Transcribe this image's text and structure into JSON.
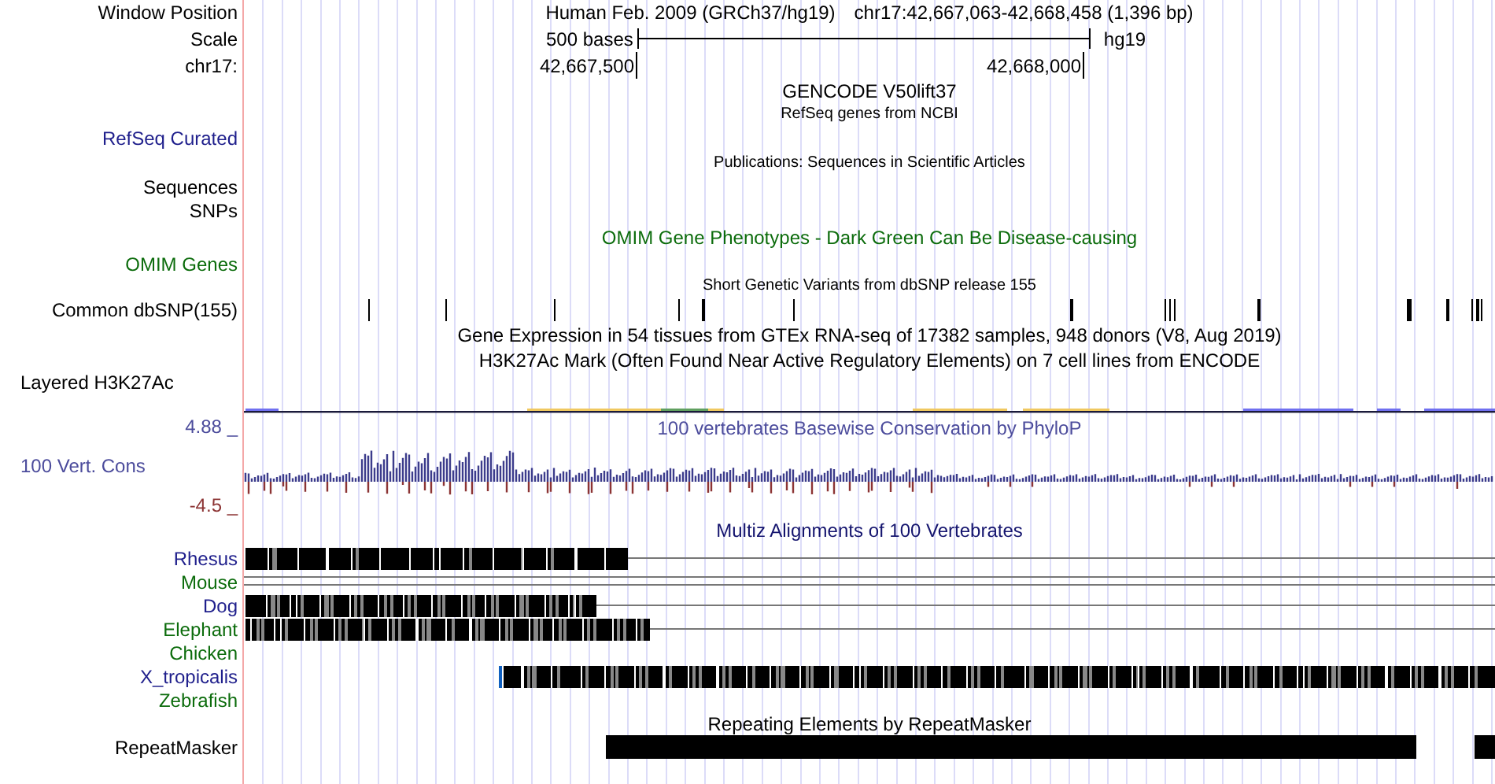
{
  "position_row": {
    "label": "Window Position",
    "assembly": "Human Feb. 2009 (GRCh37/hg19)",
    "position": "chr17:42,667,063-42,668,458 (1,396 bp)"
  },
  "scale_row": {
    "label": "Scale",
    "length": "500 bases",
    "assembly": "hg19"
  },
  "ruler_row": {
    "label": "chr17:",
    "ticks": [
      "42,667,500",
      "42,668,000"
    ]
  },
  "tracks": [
    {
      "kind": "gencode",
      "title": "GENCODE V50lift37"
    },
    {
      "kind": "refseq",
      "title": "RefSeq genes from NCBI",
      "label": "RefSeq Curated",
      "color": "#1f1f8c"
    },
    {
      "kind": "publications",
      "title": "Publications: Sequences in Scientific Articles",
      "label_lines": [
        "Sequences",
        "SNPs"
      ]
    },
    {
      "kind": "omim",
      "title": "OMIM Gene Phenotypes - Dark Green Can Be Disease-causing",
      "label": "OMIM Genes",
      "color": "#0c6c0c"
    },
    {
      "kind": "snps",
      "title": "Short Genetic Variants from dbSNP release 155",
      "label": "Common dbSNP(155)",
      "color": "#000000"
    },
    {
      "kind": "expression",
      "title": "Gene Expression in 54 tissues from GTEx RNA-seq of 17382 samples, 948 donors (V8, Aug 2019)"
    },
    {
      "kind": "layered",
      "title": "H3K27Ac Mark (Often Found Near Active Regulatory Elements) on 7 cell lines from ENCODE",
      "label": "Layered H3K27Ac",
      "color": "#000000"
    },
    {
      "kind": "conservation",
      "title": "100 vertebrates Basewise Conservation by PhyloP",
      "label": "100 Vert. Cons",
      "max": "4.88 _",
      "min": "-4.5 _",
      "color": "#4c4c9c"
    },
    {
      "kind": "multiz",
      "title": "Multiz Alignments of 100 Vertebrates",
      "species": [
        {
          "name": "Rhesus",
          "color": "#1f1f8c"
        },
        {
          "name": "Mouse",
          "color": "#0c6c0c"
        },
        {
          "name": "Dog",
          "color": "#1f1f8c"
        },
        {
          "name": "Elephant",
          "color": "#0c6c0c"
        },
        {
          "name": "Chicken",
          "color": "#0c6c0c"
        },
        {
          "name": "X_tropicalis",
          "color": "#1f1f8c"
        },
        {
          "name": "Zebrafish",
          "color": "#0c6c0c"
        }
      ]
    },
    {
      "kind": "repeats",
      "title": "Repeating Elements by RepeatMasker",
      "label": "RepeatMasker",
      "color": "#000000"
    }
  ]
}
